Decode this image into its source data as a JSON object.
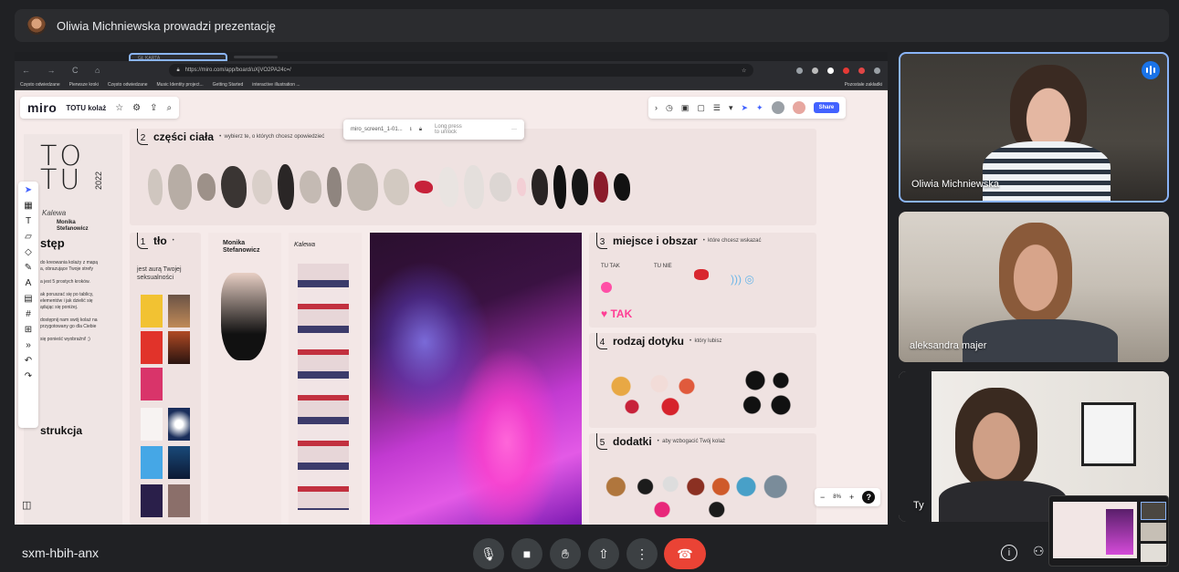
{
  "banner": {
    "presenter_text": "Oliwia Michniewska prowadzi prezentację"
  },
  "browser": {
    "tab_label": "GŁ KARTA",
    "url": "https://miro.com/app/board/uXjVO2PA24c=/",
    "bookmarks": [
      "Często odwiedzane",
      "Pierwsze kroki",
      "Często odwiedzane",
      "Music Identity project...",
      "Getting Started",
      "interactive illustration ..."
    ],
    "bookmarks_other": "Pozostałe zakładki"
  },
  "miro": {
    "logo": "miro",
    "board_name": "TOTU kolaż",
    "share_label": "Share",
    "popup": {
      "file": "miro_screen1_1-01...",
      "lock_line1": "Long press",
      "lock_line2": "to unlock"
    },
    "zoom": "8%",
    "left_panel": {
      "totu_line1": "TO",
      "totu_line2": "TU",
      "year": "2022",
      "signature": "Kalewa",
      "monika_line1": "Monika",
      "monika_line2": "Stefanowicz",
      "heading": "stęp",
      "lines": [
        "do kreowania kolaży z mapą",
        "a, obrazujące Twoje strefy",
        "",
        "a jest 5 prostych kroków.",
        "",
        "ak poruszać się po tablicy,",
        "elementów i jak dzielić się",
        "ądując się poniżej.",
        "",
        "dostępnij nam swój kolaż na",
        "przygotowany go dla Ciebie",
        "",
        "się ponieść wyobraźni! ;)"
      ],
      "instr": "strukcja"
    },
    "sections": {
      "s2": {
        "num": "2",
        "title": "części ciała",
        "desc": "wybierz te, o których chcesz opowiedzieć"
      },
      "s1": {
        "num": "1",
        "title": "tło",
        "sub_line1": "jest aurą Twojej",
        "sub_line2": "seksualności"
      },
      "monika_col": {
        "line1": "Monika",
        "line2": "Stefanowicz"
      },
      "kalewa_col": "Kalewa",
      "s3": {
        "num": "3",
        "title": "miejsce i obszar",
        "desc": "które chcesz wskazać",
        "tu_tak": "TU TAK",
        "tu_nie": "TU NIE",
        "tak": "TAK"
      },
      "s4": {
        "num": "4",
        "title": "rodzaj dotyku",
        "desc": "który lubisz"
      },
      "s5": {
        "num": "5",
        "title": "dodatki",
        "desc": "aby wzbogacić Twój kolaż"
      }
    }
  },
  "participants": [
    {
      "name": "Oliwia Michniewska",
      "speaking": true
    },
    {
      "name": "aleksandra majer",
      "speaking": false
    },
    {
      "name": "Ty",
      "speaking": false
    }
  ],
  "bottom": {
    "meeting_code": "sxm-hbih-anx"
  },
  "colors": {
    "accent": "#8ab4f8",
    "hangup": "#ea4335",
    "miro_blue": "#4262ff",
    "board_bg": "#f6ebea"
  }
}
